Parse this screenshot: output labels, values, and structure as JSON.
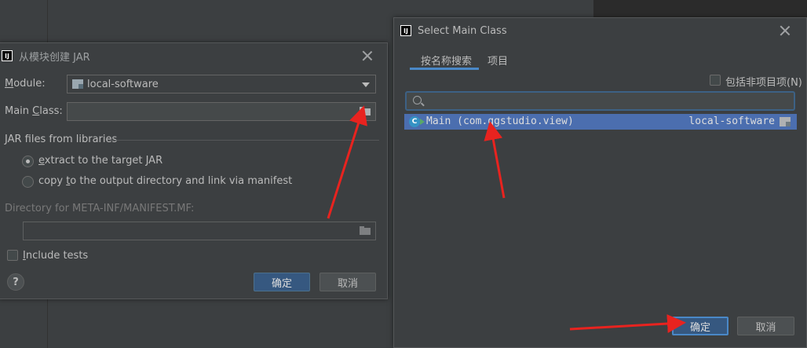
{
  "jar_dialog": {
    "title": "从模块创建 JAR",
    "module_label_u": "M",
    "module_label_rest": "odule:",
    "module_value": "local-software",
    "main_class_label_pre": "Main ",
    "main_class_label_u": "C",
    "main_class_label_post": "lass:",
    "main_class_value": "",
    "jar_files_section": "JAR files from libraries",
    "option_extract_u": "e",
    "option_extract_rest": "xtract to the target JAR",
    "option_copy_pre": "copy ",
    "option_copy_u": "t",
    "option_copy_post": "o the output directory and link via manifest",
    "manifest_dir_label": "Directory for META-INF/MANIFEST.MF:",
    "include_tests_u": "I",
    "include_tests_rest": "nclude tests",
    "help": "?",
    "ok_label": "确定",
    "cancel_label": "取消"
  },
  "select_dialog": {
    "title": "Select Main Class",
    "tabs": [
      {
        "label": "按名称搜索",
        "selected": true
      },
      {
        "label": "项目",
        "selected": false
      }
    ],
    "include_non_project_label": "包括非项目项(N)",
    "search_value": "",
    "results": [
      {
        "class_icon": "C",
        "name": "Main (com.qgstudio.view)",
        "module": "local-software"
      }
    ],
    "ok_label": "确定",
    "cancel_label": "取消"
  },
  "colors": {
    "background": "#3c3f41",
    "selection": "#4b6eaf",
    "primary_button": "#365880",
    "annotation_arrow": "#e8231f"
  }
}
